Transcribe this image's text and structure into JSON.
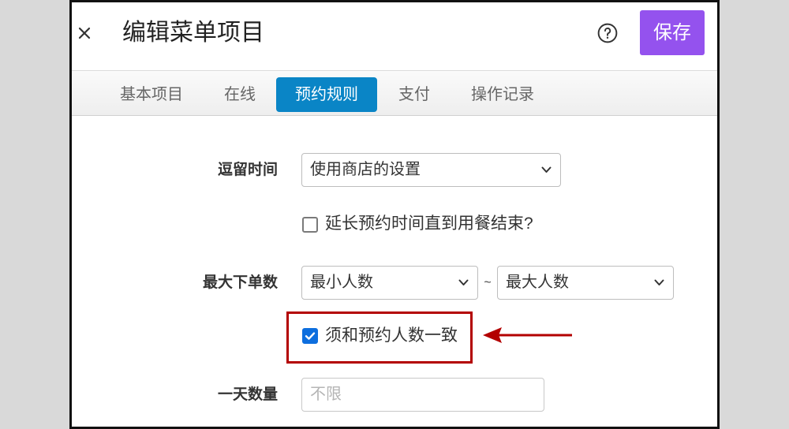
{
  "header": {
    "title": "编辑菜单项目",
    "save_label": "保存",
    "close_icon": "close-icon",
    "help_icon": "help-icon"
  },
  "tabs": [
    {
      "label": "基本项目",
      "active": false
    },
    {
      "label": "在线",
      "active": false
    },
    {
      "label": "预约规则",
      "active": true
    },
    {
      "label": "支付",
      "active": false
    },
    {
      "label": "操作记录",
      "active": false
    }
  ],
  "form": {
    "stay_time": {
      "label": "逗留时间",
      "value": "使用商店的设置"
    },
    "extend_checkbox": {
      "label": "延长预约时间直到用餐结束?",
      "checked": false
    },
    "max_orders": {
      "label": "最大下单数",
      "min_value": "最小人数",
      "separator": "~",
      "max_value": "最大人数"
    },
    "match_checkbox": {
      "label": "须和预约人数一致",
      "checked": true
    },
    "daily_quantity": {
      "label": "一天数量",
      "placeholder": "不限",
      "value": ""
    }
  },
  "colors": {
    "save_button": "#9452ee",
    "active_tab": "#0a85c6",
    "checkbox_checked": "#0d6ede",
    "annotation": "#b30000",
    "page_background": "#d9d9d9"
  }
}
